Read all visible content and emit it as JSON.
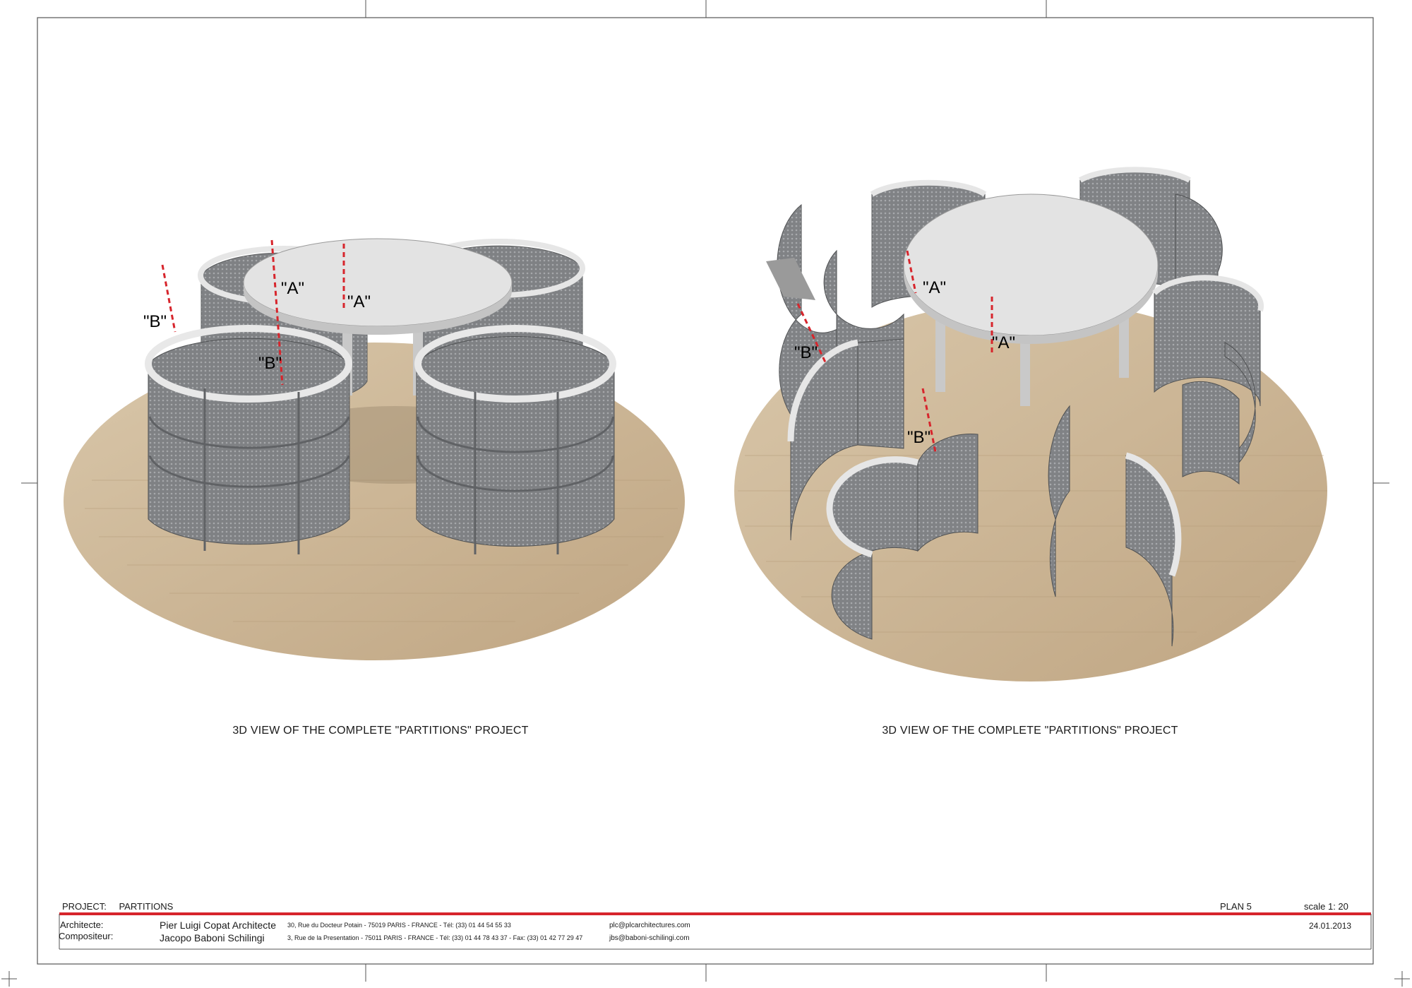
{
  "views": [
    {
      "caption": "3D VIEW OF THE COMPLETE \"PARTITIONS\" PROJECT",
      "markers": [
        "\"A\"",
        "\"A\"",
        "\"B\"",
        "\"B\""
      ]
    },
    {
      "caption": "3D VIEW OF THE COMPLETE \"PARTITIONS\" PROJECT",
      "markers": [
        "\"A\"",
        "\"A\"",
        "\"B\"",
        "\"B\""
      ]
    }
  ],
  "title_block": {
    "project_label": "PROJECT:",
    "project_name": "PARTITIONS",
    "plan": "PLAN 5",
    "scale": "scale 1: 20",
    "date": "24.01.2013",
    "role1": "Architecte:",
    "role2": "Compositeur:",
    "name1": "Pier Luigi Copat Architecte",
    "name2": "Jacopo Baboni Schilingi",
    "address1": "30, Rue du Docteur Potain -  75019 PARIS  -  FRANCE  -  Tél: (33) 01 44 54 55 33",
    "address2": "3, Rue de la Presentation - 75011 PARIS - FRANCE - Tél: (33) 01 44 78 43 37 - Fax: (33) 01 42 77 29 47",
    "email1": "plc@plcarchitectures.com",
    "email2": "jbs@baboni-schilingi.com"
  },
  "colors": {
    "accent_red": "#d7252c",
    "wood": "#c9b394",
    "panel": "#8e9093",
    "table_top": "#e3e3e3"
  }
}
